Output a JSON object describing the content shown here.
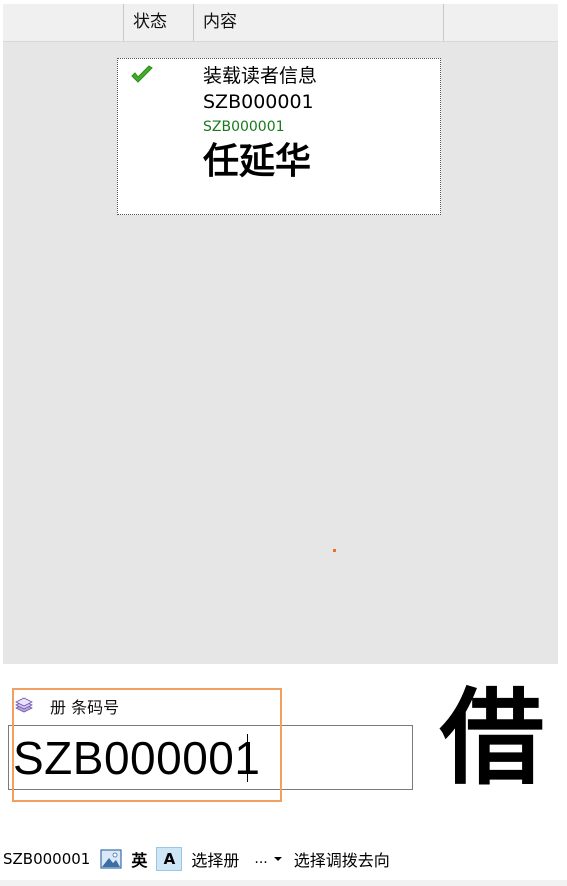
{
  "list": {
    "columns": [
      {
        "label": ""
      },
      {
        "label": "状态"
      },
      {
        "label": "内容"
      },
      {
        "label": ""
      }
    ],
    "items": [
      {
        "status_icon": "check-icon",
        "title": "装载读者信息",
        "barcode": "SZB000001",
        "barcode_small": "SZB000001",
        "name": "任延华"
      }
    ]
  },
  "input": {
    "icon": "book-stack-icon",
    "label": "册 条码号",
    "value": "SZB000001"
  },
  "action": {
    "glyph": "借"
  },
  "status_bar": {
    "barcode": "SZB000001",
    "image_icon": "picture-icon",
    "ime_label": "英",
    "font_label": "A",
    "select_item_label": "选择册",
    "more_label": "...",
    "select_transfer_label": "选择调拨去向"
  },
  "colors": {
    "panel_background": "#e6e6e6",
    "highlight_border": "#f0a060",
    "small_barcode_text": "#1a7a1a",
    "check_green": "#3fae2a",
    "font_toggle_background": "#cfe6f7"
  }
}
